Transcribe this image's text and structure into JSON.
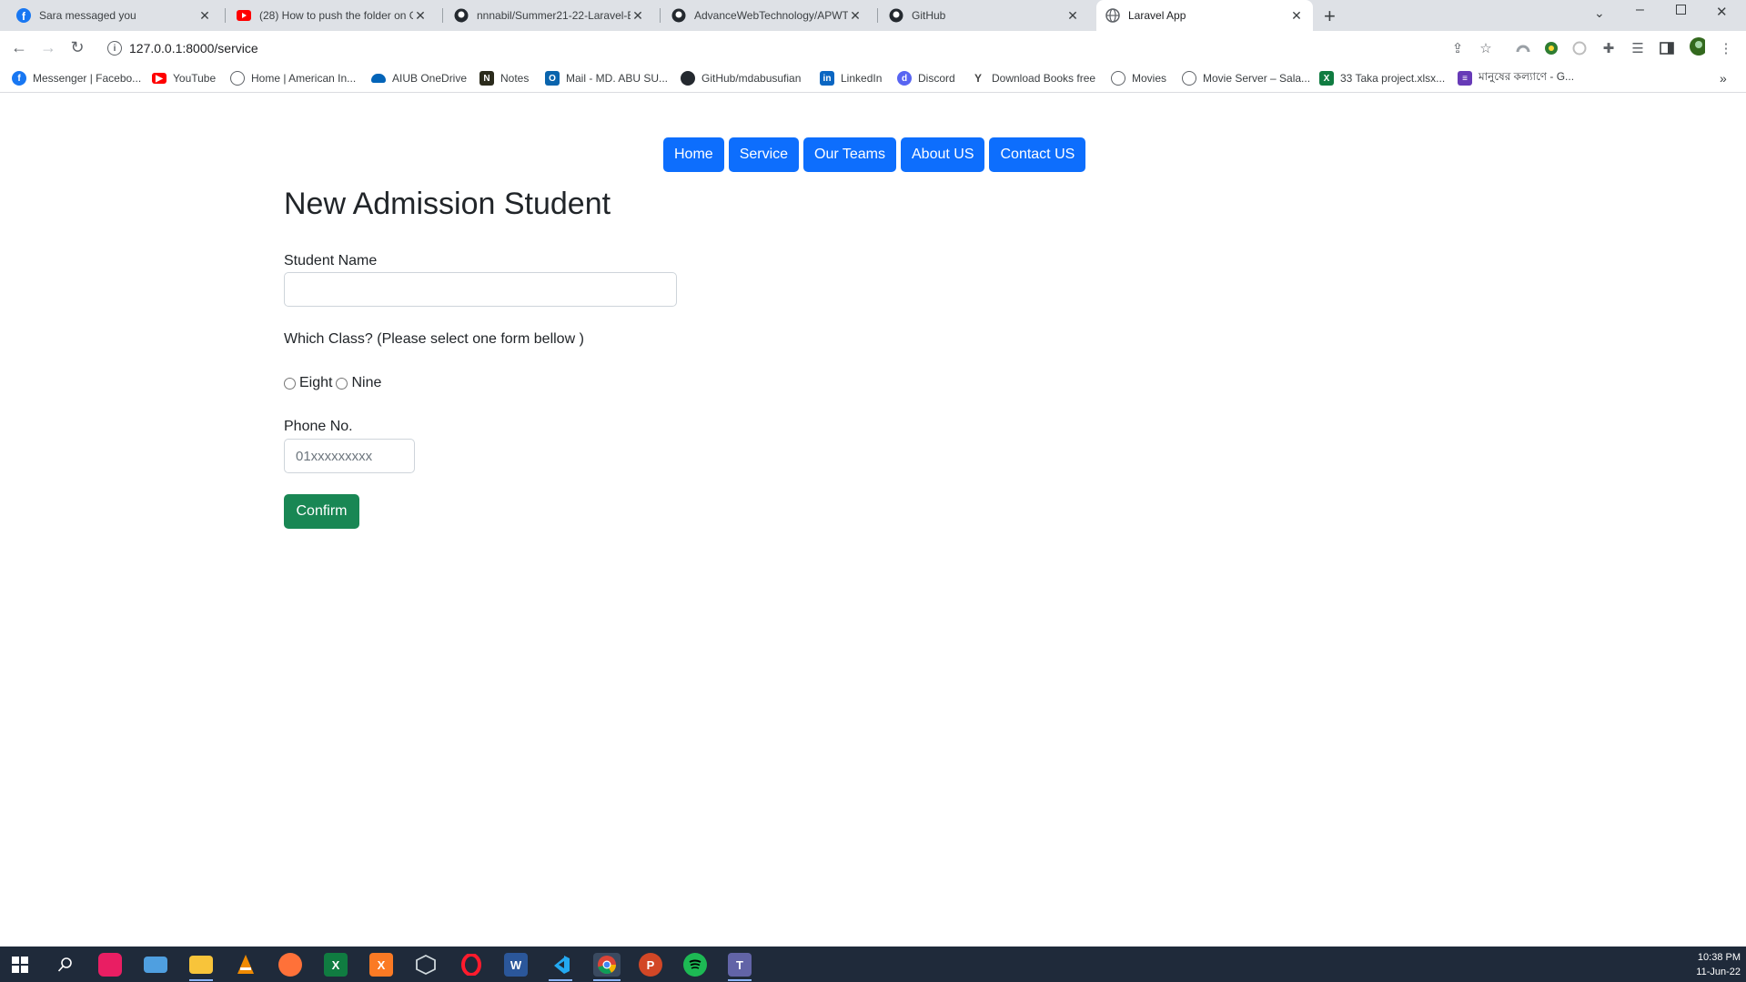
{
  "browser": {
    "tabs": [
      {
        "title": "Sara messaged you",
        "icon": "facebook-icon",
        "color": "#1877f2",
        "active": false
      },
      {
        "title": "(28) How to push the folder on G",
        "icon": "youtube-icon",
        "color": "#ff0000",
        "active": false
      },
      {
        "title": "nnnabil/Summer21-22-Laravel-B",
        "icon": "github-icon",
        "color": "#24292f",
        "active": false
      },
      {
        "title": "AdvanceWebTechnology/APWT",
        "icon": "github-icon",
        "color": "#24292f",
        "active": false
      },
      {
        "title": "GitHub",
        "icon": "github-icon",
        "color": "#24292f",
        "active": false
      },
      {
        "title": "Laravel App",
        "icon": "globe-icon",
        "color": "#5f6368",
        "active": true
      }
    ],
    "new_tab_symbol": "+",
    "url": "127.0.0.1:8000/service",
    "bookmarks": [
      {
        "label": "Messenger | Facebo...",
        "icon": "facebook-icon",
        "color": "#1877f2"
      },
      {
        "label": "YouTube",
        "icon": "youtube-icon",
        "color": "#ff0000"
      },
      {
        "label": "Home | American In...",
        "icon": "globe-icon",
        "color": "#5f6368"
      },
      {
        "label": "AIUB OneDrive",
        "icon": "onedrive-icon",
        "color": "#0364b8"
      },
      {
        "label": "Notes",
        "icon": "notes-icon",
        "color": "#3c3c1c"
      },
      {
        "label": "Mail - MD. ABU SU...",
        "icon": "outlook-icon",
        "color": "#0a64ad"
      },
      {
        "label": "GitHub/mdabusufian",
        "icon": "github-icon",
        "color": "#24292f"
      },
      {
        "label": "LinkedIn",
        "icon": "linkedin-icon",
        "color": "#0a66c2"
      },
      {
        "label": "Discord",
        "icon": "discord-icon",
        "color": "#5865f2"
      },
      {
        "label": "Download Books free",
        "icon": "book-icon",
        "color": "#444444"
      },
      {
        "label": "Movies",
        "icon": "globe-icon",
        "color": "#5f6368"
      },
      {
        "label": "Movie Server – Sala...",
        "icon": "globe-icon",
        "color": "#5f6368"
      },
      {
        "label": "33 Taka project.xlsx...",
        "icon": "excel-icon",
        "color": "#107c41"
      },
      {
        "label": "মানুষের কল্যাণে - G...",
        "icon": "forms-icon",
        "color": "#673ab7"
      }
    ]
  },
  "page": {
    "nav": [
      "Home",
      "Service",
      "Our Teams",
      "About US",
      "Contact US"
    ],
    "title": "New Admission Student",
    "form": {
      "name_label": "Student Name",
      "name_value": "",
      "class_question": "Which Class? (Please select one form bellow )",
      "class_options": [
        "Eight",
        "Nine"
      ],
      "phone_label": "Phone No.",
      "phone_placeholder": "01xxxxxxxxx",
      "confirm_label": "Confirm"
    },
    "colors": {
      "primary": "#0d6efd",
      "success": "#198754"
    }
  },
  "taskbar": {
    "apps": [
      {
        "name": "windows-start-icon",
        "color": "#ffffff"
      },
      {
        "name": "search-icon",
        "color": "#ffffff"
      },
      {
        "name": "app-icon-pink",
        "color": "#e91e63"
      },
      {
        "name": "app-icon-blue",
        "color": "#4f9fe0"
      },
      {
        "name": "file-explorer-icon",
        "color": "#f8c43a"
      },
      {
        "name": "vlc-icon",
        "color": "#f08a00"
      },
      {
        "name": "firefox-icon",
        "color": "#ff7139"
      },
      {
        "name": "excel-icon",
        "color": "#107c41"
      },
      {
        "name": "xampp-icon",
        "color": "#fb7a24"
      },
      {
        "name": "virtualbox-icon",
        "color": "#cfd8dc"
      },
      {
        "name": "opera-icon",
        "color": "#ff1b2d"
      },
      {
        "name": "word-icon",
        "color": "#2b579a"
      },
      {
        "name": "vscode-icon",
        "color": "#23a9f2"
      },
      {
        "name": "chrome-icon",
        "color": "#4285f4"
      },
      {
        "name": "powerpoint-icon",
        "color": "#d24726"
      },
      {
        "name": "spotify-icon",
        "color": "#1db954"
      },
      {
        "name": "teams-icon",
        "color": "#6264a7"
      }
    ],
    "time": "10:38 PM",
    "date": "11-Jun-22"
  }
}
